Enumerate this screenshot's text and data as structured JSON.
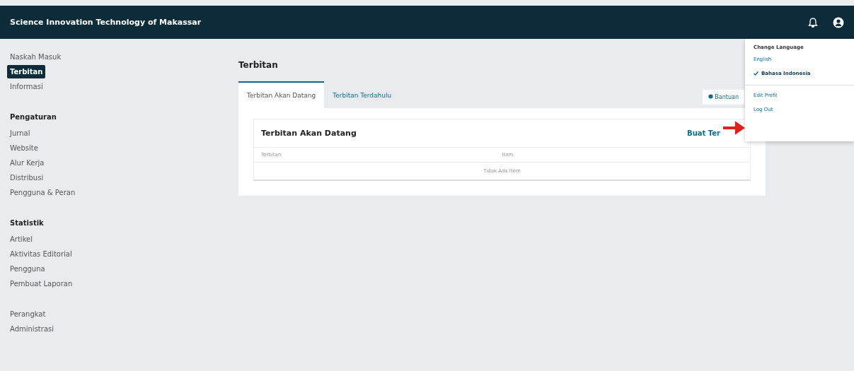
{
  "header": {
    "title": "Science Innovation Technology of Makassar"
  },
  "sidebar": {
    "groups": [
      {
        "items": [
          {
            "label": "Naskah Masuk",
            "selected": false
          },
          {
            "label": "Terbitan",
            "selected": true
          },
          {
            "label": "Informasi",
            "selected": false
          }
        ]
      },
      {
        "title": "Pengaturan",
        "items": [
          {
            "label": "Jurnal",
            "selected": false
          },
          {
            "label": "Website",
            "selected": false
          },
          {
            "label": "Alur Kerja",
            "selected": false
          },
          {
            "label": "Distribusi",
            "selected": false
          },
          {
            "label": "Pengguna & Peran",
            "selected": false
          }
        ]
      },
      {
        "title": "Statistik",
        "items": [
          {
            "label": "Artikel",
            "selected": false
          },
          {
            "label": "Aktivitas Editorial",
            "selected": false
          },
          {
            "label": "Pengguna",
            "selected": false
          },
          {
            "label": "Pembuat Laporan",
            "selected": false
          }
        ]
      },
      {
        "items": [
          {
            "label": "Perangkat",
            "selected": false
          },
          {
            "label": "Administrasi",
            "selected": false
          }
        ]
      }
    ]
  },
  "page_title": "Terbitan",
  "tabs": [
    {
      "label": "Terbitan Akan Datang",
      "selected": true
    },
    {
      "label": "Terbitan Terdahulu",
      "selected": false
    }
  ],
  "help": "Bantuan",
  "panel": {
    "title": "Terbitan Akan Datang",
    "action": "Buat Ter",
    "columns": [
      "Terbitan",
      "Item"
    ],
    "empty": "Tidak Ada Item"
  },
  "menu": {
    "title": "Change Language",
    "languages": [
      {
        "label": "English",
        "selected": false
      },
      {
        "label": "Bahasa Indonesia",
        "selected": true
      }
    ],
    "actions": [
      "Edit Profil",
      "Log Out"
    ]
  }
}
